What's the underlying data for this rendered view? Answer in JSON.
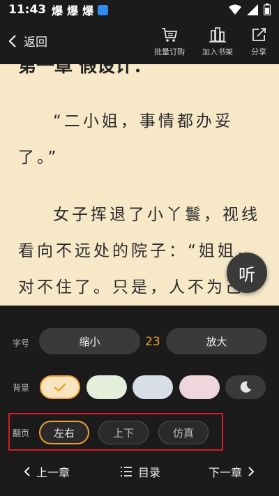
{
  "status_bar": {
    "time": "11:43",
    "notification_glyph": "爆",
    "icons": [
      "notification-icon",
      "notification-icon",
      "notification-icon",
      "app-badge-icon",
      "wifi-icon",
      "signal-icon",
      "battery-icon"
    ]
  },
  "top_bar": {
    "back_label": "返回",
    "tools": [
      {
        "label": "批量订购",
        "icon": "cart-icon"
      },
      {
        "label": "加入书架",
        "icon": "bookshelf-icon"
      },
      {
        "label": "分享",
        "icon": "share-icon"
      }
    ]
  },
  "reader": {
    "chapter_title": "第一章 假设计：",
    "paragraphs": [
      "“二小姐，事情都办妥了。”",
      "女子挥退了小丫鬟，视线看向不远处的院子：“姐姐，对不住了。只是，人不为己天"
    ],
    "background_color": "#f7e8c8",
    "listen_label": "听"
  },
  "settings": {
    "font_size": {
      "label": "字号",
      "decrease_label": "缩小",
      "value": "23",
      "increase_label": "放大"
    },
    "background": {
      "label": "背景",
      "swatches": [
        {
          "name": "beige",
          "color": "#f7e4c0",
          "selected": true
        },
        {
          "name": "light-green",
          "color": "#e3eedb",
          "selected": false
        },
        {
          "name": "light-blue",
          "color": "#d8dee8",
          "selected": false
        },
        {
          "name": "light-pink",
          "color": "#efd6dd",
          "selected": false
        },
        {
          "name": "night",
          "color": "#3a3a3a",
          "selected": false
        }
      ]
    },
    "page_turn": {
      "label": "翻页",
      "options": [
        {
          "label": "左右",
          "active": true
        },
        {
          "label": "上下",
          "active": false
        },
        {
          "label": "仿真",
          "active": false
        }
      ]
    }
  },
  "bottom_nav": {
    "prev_label": "上一章",
    "toc_label": "目录",
    "next_label": "下一章"
  },
  "colors": {
    "accent": "#f0a030",
    "highlight_box": "#d21b24",
    "panel_bg": "#1b1b1b"
  }
}
